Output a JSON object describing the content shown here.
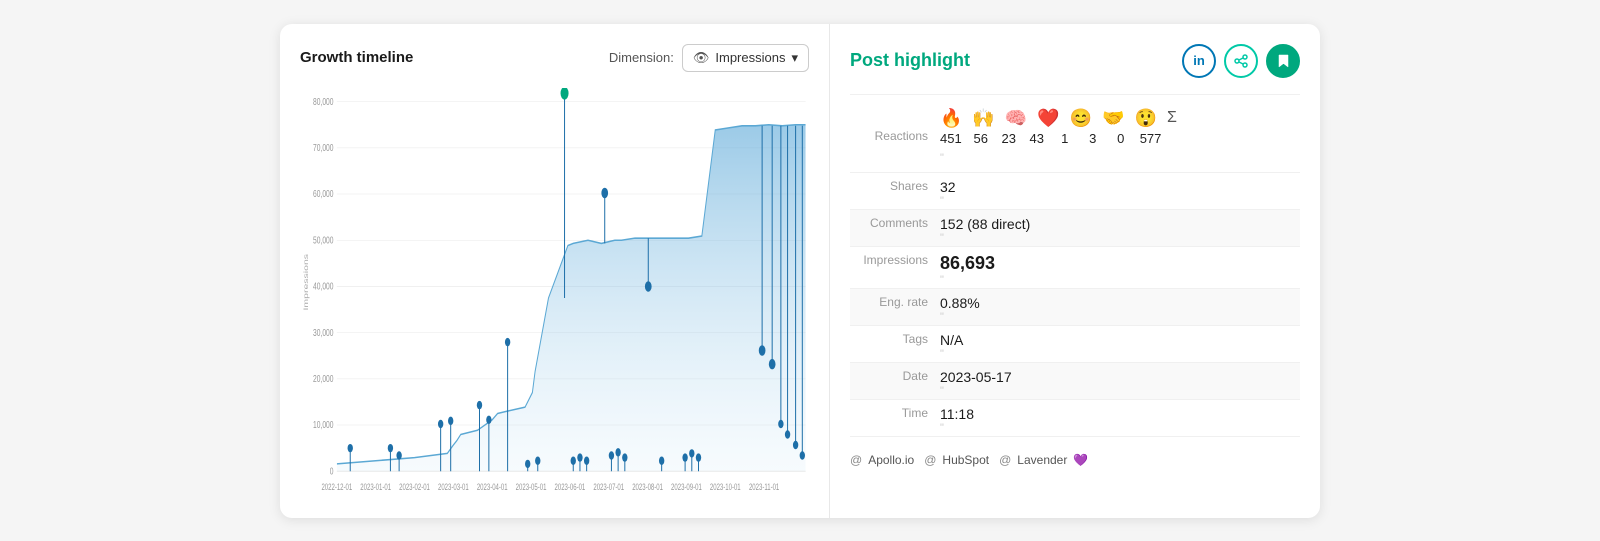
{
  "leftPanel": {
    "title": "Growth timeline",
    "dimension": {
      "label": "Dimension:",
      "value": "Impressions"
    },
    "chart": {
      "yLabels": [
        "0",
        "10,000",
        "20,000",
        "30,000",
        "40,000",
        "50,000",
        "60,000",
        "70,000",
        "80,000"
      ],
      "xLabels": [
        "2022-12-01",
        "2023-01-01",
        "2023-02-01",
        "2023-03-01",
        "2023-04-01",
        "2023-05-01",
        "2023-06-01",
        "2023-07-01",
        "2023-08-01",
        "2023-09-01",
        "2023-10-01",
        "2023-11-01"
      ],
      "yAxisLabel": "Impressions"
    }
  },
  "rightPanel": {
    "title": "Post highlight",
    "actions": {
      "linkedin": "in",
      "share": "→",
      "bookmark": "🔖"
    },
    "reactions": {
      "label": "Reactions",
      "icons": [
        "🔥",
        "🙌",
        "🧠",
        "❤️",
        "😊",
        "🤝",
        "😲",
        "Σ"
      ],
      "values": [
        "451",
        "56",
        "23",
        "43",
        "1",
        "3",
        "0",
        "577"
      ],
      "sub": "\""
    },
    "rows": [
      {
        "label": "Shares",
        "value": "32",
        "large": false,
        "sub": "\""
      },
      {
        "label": "Comments",
        "value": "152 (88 direct)",
        "large": false,
        "sub": "\""
      },
      {
        "label": "Impressions",
        "value": "86,693",
        "large": true,
        "sub": "\""
      },
      {
        "label": "Eng. rate",
        "value": "0.88%",
        "large": false,
        "sub": "\""
      },
      {
        "label": "Tags",
        "value": "N/A",
        "large": false,
        "sub": "\""
      },
      {
        "label": "Date",
        "value": "2023-05-17",
        "large": false,
        "sub": "\""
      },
      {
        "label": "Time",
        "value": "11:18",
        "large": false,
        "sub": "\""
      }
    ],
    "tags": [
      {
        "label": "Apollo.io",
        "prefix": "@"
      },
      {
        "label": "HubSpot",
        "prefix": "@"
      },
      {
        "label": "Lavender",
        "prefix": "@",
        "heart": true
      }
    ]
  }
}
